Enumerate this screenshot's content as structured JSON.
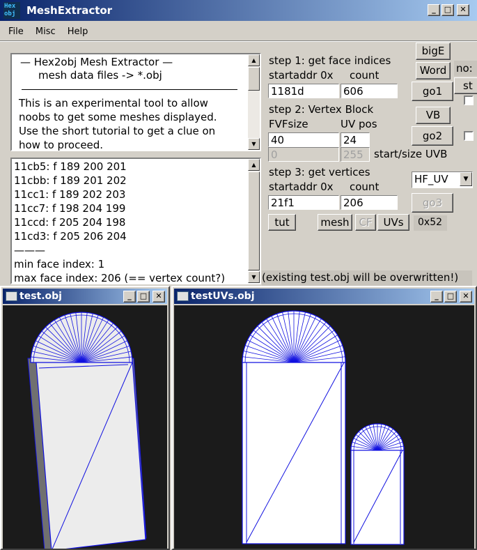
{
  "window": {
    "title": "MeshExtractor",
    "icon_text": "Hex obj"
  },
  "menu": [
    "File",
    "Misc",
    "Help"
  ],
  "info": {
    "title": "—   Hex2obj Mesh Extractor   —",
    "subtitle": "mesh data files -> *.obj",
    "lines": [
      "This is an experimental tool to allow",
      "noobs to get some meshes displayed.",
      "Use the short tutorial to get a clue on",
      "how to proceed."
    ]
  },
  "log": {
    "lines": [
      "11cb5: f  189 200 201",
      "11cbb: f  189 201 202",
      "11cc1: f  189 202 203",
      "11cc7: f  198 204 199",
      "11ccd: f  205 204 198",
      "11cd3: f  205 206 204",
      "———",
      "min face index: 1",
      "max face index: 206 (== vertex count?)"
    ]
  },
  "step1": {
    "title": "step 1: get face indices",
    "startaddr_label": "startaddr 0x",
    "count_label": "count",
    "startaddr_value": "1181d",
    "count_value": "606"
  },
  "step2": {
    "title": "step 2: Vertex Block",
    "fvf_label": "FVFsize",
    "uvpos_label": "UV pos",
    "fvf_value": "40",
    "uvpos_value": "24",
    "uvb_start": "0",
    "uvb_size": "255",
    "uvb_label": "start/size UVB"
  },
  "step3": {
    "title": "step 3: get vertices",
    "startaddr_label": "startaddr 0x",
    "count_label": "count",
    "startaddr_value": "21f1",
    "count_value": "206"
  },
  "buttons": {
    "bigE": "bigE",
    "word": "Word",
    "go1": "go1",
    "vb": "VB",
    "go2": "go2",
    "go3": "go3",
    "tut": "tut",
    "mesh": "mesh",
    "cf": "CF",
    "uvs": "UVs"
  },
  "select": {
    "value": "HF_UV"
  },
  "hex_label": "0x52",
  "overwrite_note": "(existing test.obj will be overwritten!)",
  "partial_right": {
    "no_label": "no:",
    "st_label": "st"
  },
  "win_test": {
    "title": "test.obj"
  },
  "win_uvs": {
    "title": "testUVs.obj"
  },
  "colors": {
    "titlebar": "#0a246a",
    "wire": "#1010e0",
    "canvas": "#1b1b1b",
    "face": "#ececec"
  }
}
